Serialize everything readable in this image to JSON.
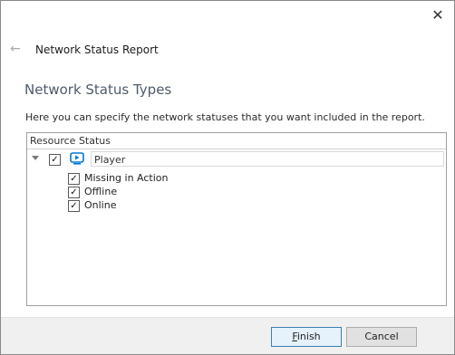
{
  "window": {
    "close_glyph": "✕"
  },
  "header": {
    "back_glyph": "←",
    "title": "Network Status Report"
  },
  "section": {
    "heading": "Network Status Types",
    "description": "Here you can specify the network statuses that you want included in the report."
  },
  "panel": {
    "header_label": "Resource Status",
    "root": {
      "label": "Player",
      "checked": true
    },
    "items": [
      {
        "label": "Missing in Action",
        "checked": true
      },
      {
        "label": "Offline",
        "checked": true
      },
      {
        "label": "Online",
        "checked": true
      }
    ],
    "check_glyph": "✓"
  },
  "footer": {
    "finish_first": "F",
    "finish_rest": "inish",
    "cancel_label": "Cancel"
  },
  "colors": {
    "accent": "#0078d7",
    "heading": "#4d5b6b",
    "button_primary_border": "#3c7fb1"
  }
}
